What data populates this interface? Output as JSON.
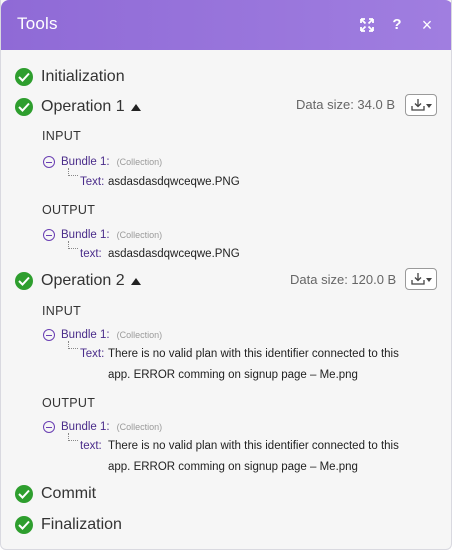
{
  "window": {
    "title": "Tools",
    "expand_icon": "expand-arrows-icon",
    "help_label": "?",
    "close_label": "×"
  },
  "steps": {
    "initialization": "Initialization",
    "operation1": {
      "label": "Operation 1",
      "data_size": "Data size: 34.0 B",
      "input_label": "INPUT",
      "output_label": "OUTPUT",
      "input": {
        "bundle": "Bundle 1:",
        "type": "(Collection)",
        "key": "Text:",
        "value": "asdasdasdqwceqwe.PNG"
      },
      "output": {
        "bundle": "Bundle 1:",
        "type": "(Collection)",
        "key": "text:",
        "value": "asdasdasdqwceqwe.PNG"
      }
    },
    "operation2": {
      "label": "Operation 2",
      "data_size": "Data size: 120.0 B",
      "input_label": "INPUT",
      "output_label": "OUTPUT",
      "input": {
        "bundle": "Bundle 1:",
        "type": "(Collection)",
        "key": "Text:",
        "value_line1": "There is no valid plan with this identifier connected to this",
        "value_line2": "app. ERROR comming on signup page – Me.png"
      },
      "output": {
        "bundle": "Bundle 1:",
        "type": "(Collection)",
        "key": "text:",
        "value_line1": "There is no valid plan with this identifier connected to this",
        "value_line2": "app. ERROR comming on signup page – Me.png"
      }
    },
    "commit": "Commit",
    "finalization": "Finalization"
  },
  "colors": {
    "header_gradient_start": "#8f6ad6",
    "header_gradient_end": "#a07ee0",
    "success_green": "#2e9e2e",
    "bundle_purple": "#4a2c8a"
  }
}
